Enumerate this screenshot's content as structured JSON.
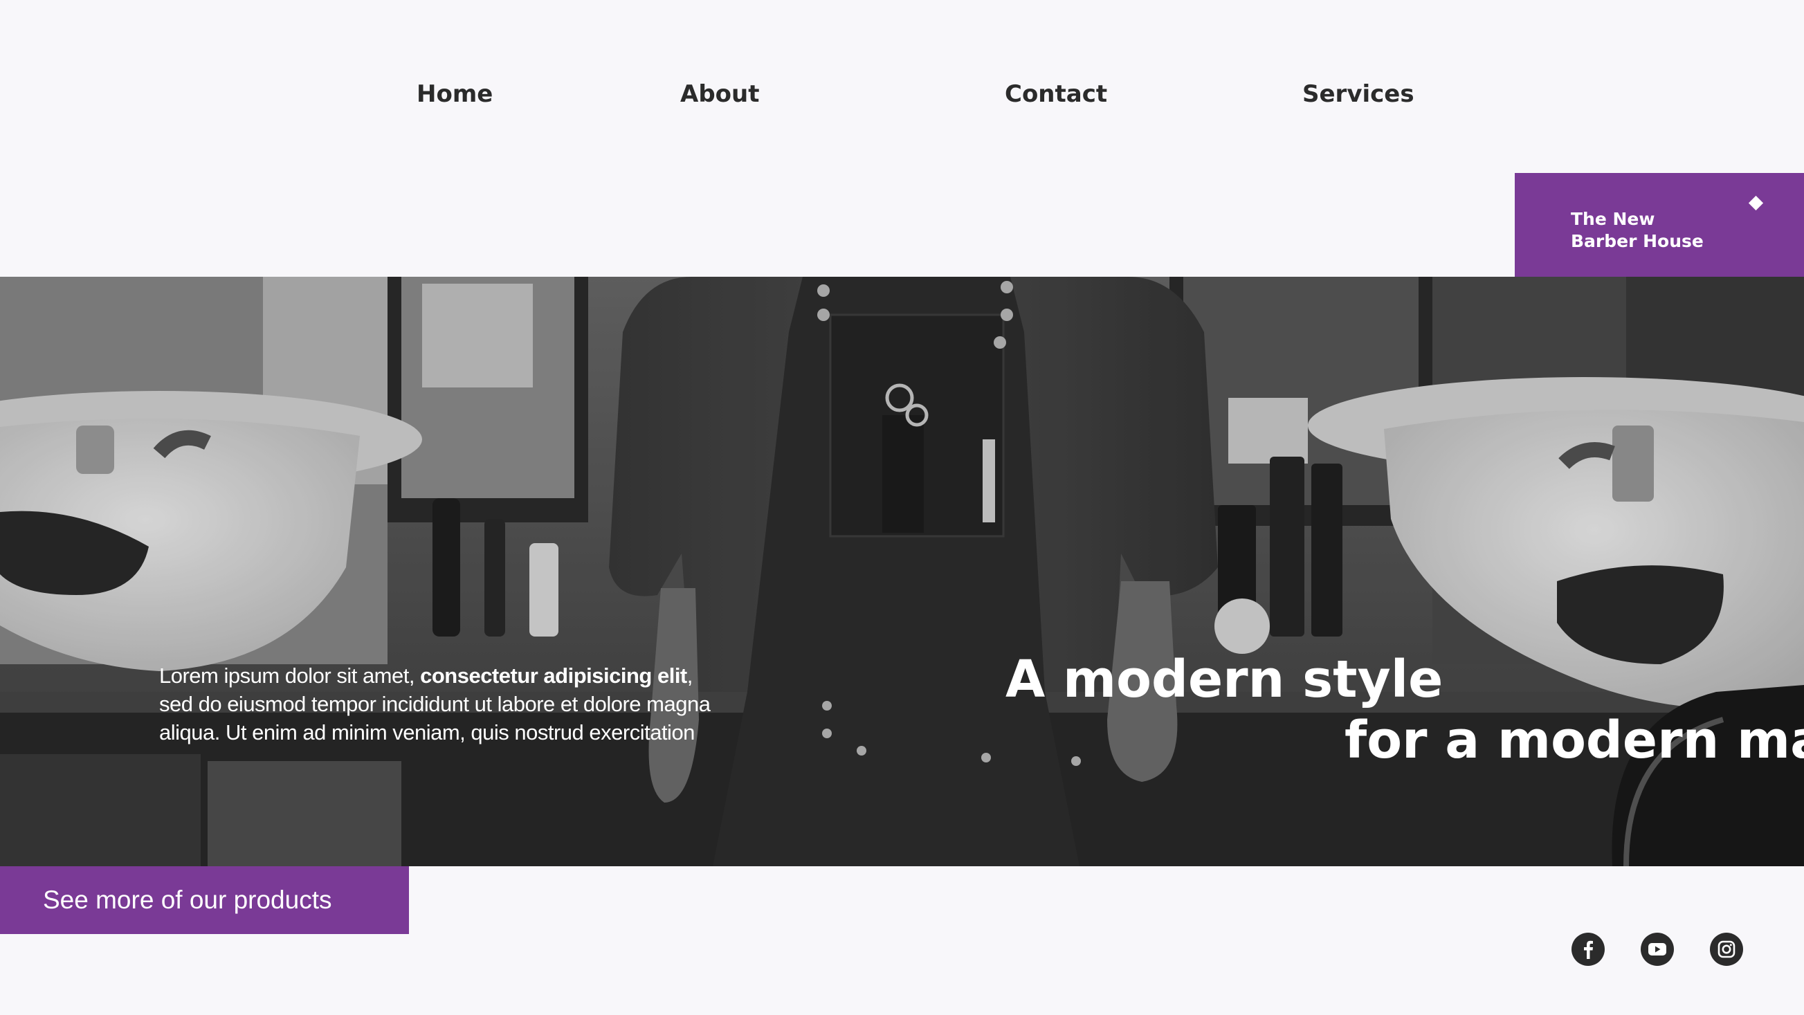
{
  "nav": {
    "home": "Home",
    "about": "About",
    "contact": "Contact",
    "services": "Services"
  },
  "brand": {
    "line1": "The New",
    "line2": "Barber House"
  },
  "hero": {
    "body_pre": "Lorem ipsum dolor sit amet, ",
    "body_bold": "consectetur adipisicing elit",
    "body_post": ", sed do eiusmod tempor incididunt ut labore et dolore magna aliqua. Ut enim ad minim veniam, quis nostrud exercitation",
    "headline_1": "A modern style",
    "headline_2": "for a modern man"
  },
  "cta": {
    "label": "See more of our products"
  },
  "social": {
    "icons": [
      "facebook-icon",
      "youtube-icon",
      "instagram-icon"
    ]
  },
  "colors": {
    "accent": "#7a3a96",
    "background": "#f8f7fa",
    "text_dark": "#2b2b2b"
  }
}
